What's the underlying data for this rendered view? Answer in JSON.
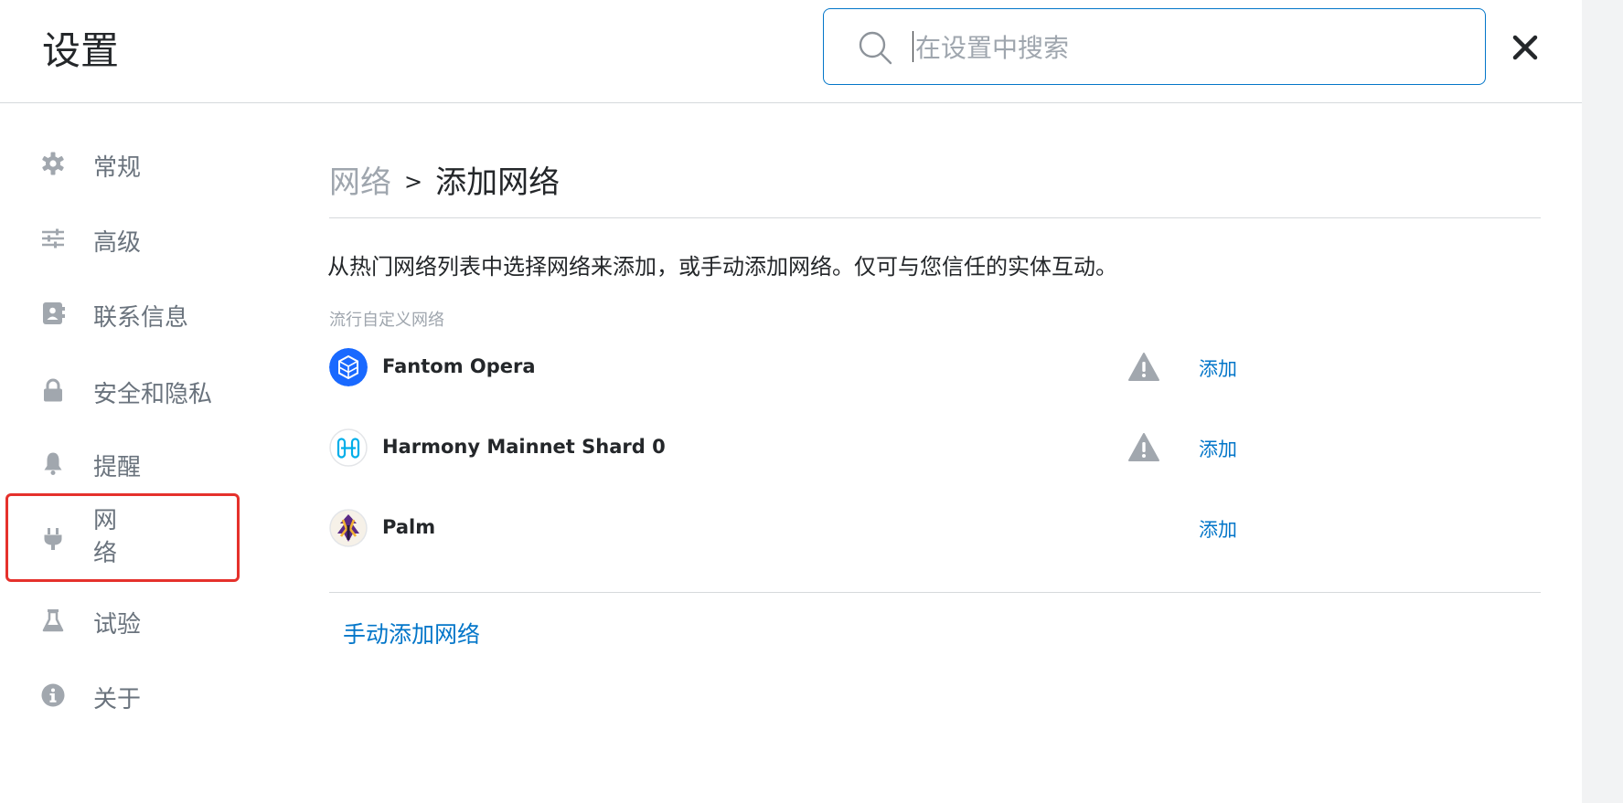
{
  "header": {
    "title": "设置",
    "search_placeholder": "在设置中搜索",
    "close_label": "×"
  },
  "sidebar": {
    "items": [
      {
        "label": "常规",
        "icon": "gear-icon"
      },
      {
        "label": "高级",
        "icon": "sliders-icon"
      },
      {
        "label": "联系信息",
        "icon": "contacts-icon"
      },
      {
        "label": "安全和隐私",
        "icon": "lock-icon"
      },
      {
        "label": "提醒",
        "icon": "bell-icon"
      },
      {
        "label": "网络",
        "icon": "plug-icon",
        "active": true
      },
      {
        "label": "试验",
        "icon": "flask-icon"
      },
      {
        "label": "关于",
        "icon": "info-icon"
      }
    ]
  },
  "main": {
    "breadcrumb": {
      "parent": "网络",
      "separator": ">",
      "current": "添加网络"
    },
    "description": "从热门网络列表中选择网络来添加，或手动添加网络。仅可与您信任的实体互动。",
    "section_label": "流行自定义网络",
    "networks": [
      {
        "name": "Fantom Opera",
        "warning": true,
        "action": "添加",
        "logo": "fantom-logo"
      },
      {
        "name": "Harmony Mainnet Shard 0",
        "warning": true,
        "action": "添加",
        "logo": "harmony-logo"
      },
      {
        "name": "Palm",
        "warning": false,
        "action": "添加",
        "logo": "palm-logo"
      }
    ],
    "manual_add_label": "手动添加网络"
  },
  "colors": {
    "accent": "#0376c9",
    "muted_text": "#9fa6ae",
    "sidebar_icon": "#a1a7ae",
    "highlight_frame": "#e5312c",
    "fantom_blue": "#1969ff",
    "harmony_teal": "#00aee9"
  }
}
